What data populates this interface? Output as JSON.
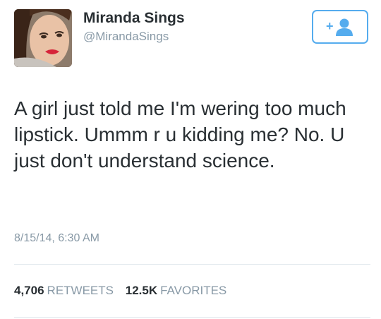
{
  "user": {
    "name": "Miranda Sings",
    "handle": "@MirandaSings"
  },
  "follow_button": {
    "icon": "add-user-icon",
    "label": "+"
  },
  "tweet": {
    "text": "A girl just told me I'm wering too much lipstick. Ummm r u kidding me? No. U just don't understand science.",
    "timestamp": "8/15/14, 6:30 AM"
  },
  "stats": {
    "retweets": {
      "count": "4,706",
      "label": "RETWEETS"
    },
    "favorites": {
      "count": "12.5K",
      "label": "FAVORITES"
    }
  },
  "colors": {
    "accent": "#55acee",
    "text": "#292f33",
    "muted": "#8899a6",
    "divider": "#e1e8ed"
  }
}
